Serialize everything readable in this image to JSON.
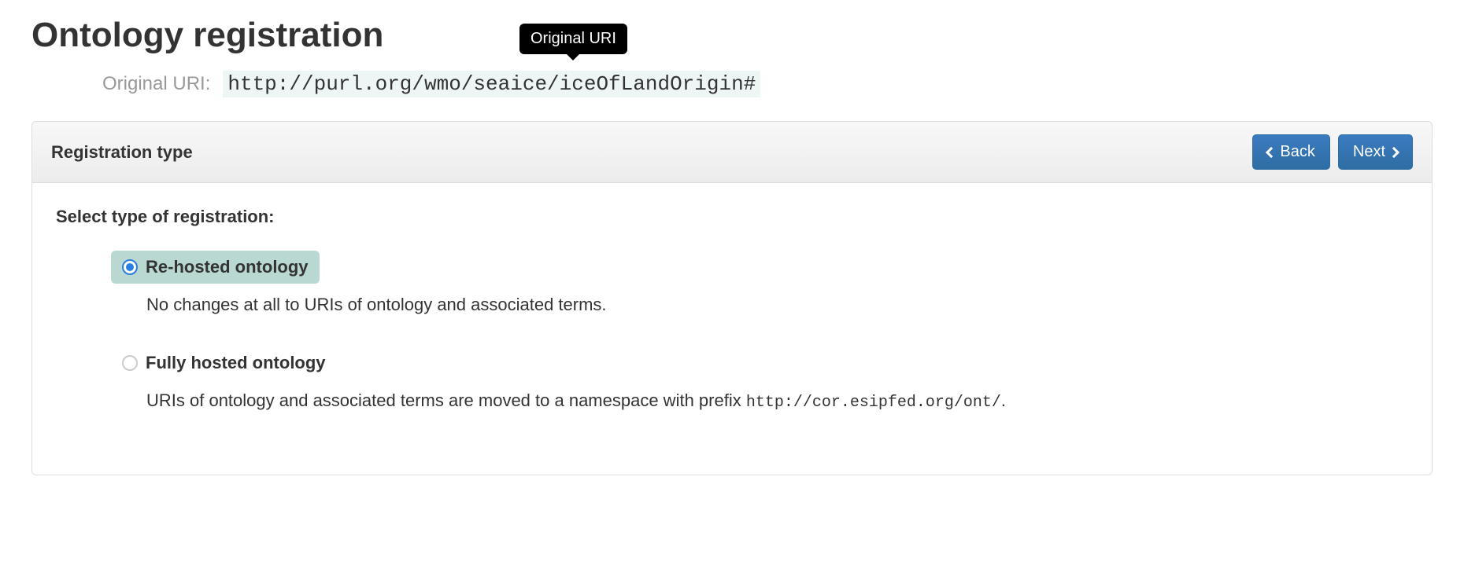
{
  "page": {
    "title": "Ontology registration"
  },
  "uri": {
    "label": "Original URI:",
    "value": "http://purl.org/wmo/seaice/iceOfLandOrigin#",
    "tooltip": "Original URI"
  },
  "panel": {
    "title": "Registration type",
    "back_label": "Back",
    "next_label": "Next"
  },
  "form": {
    "section_label": "Select type of registration:",
    "options": {
      "rehosted": {
        "label": "Re-hosted ontology",
        "desc": "No changes at all to URIs of ontology and associated terms.",
        "selected": true
      },
      "fully": {
        "label": "Fully hosted ontology",
        "desc_prefix": "URIs of ontology and associated terms are moved to a namespace with prefix ",
        "desc_code": "http://cor.esipfed.org/ont/",
        "desc_suffix": ".",
        "selected": false
      }
    }
  }
}
